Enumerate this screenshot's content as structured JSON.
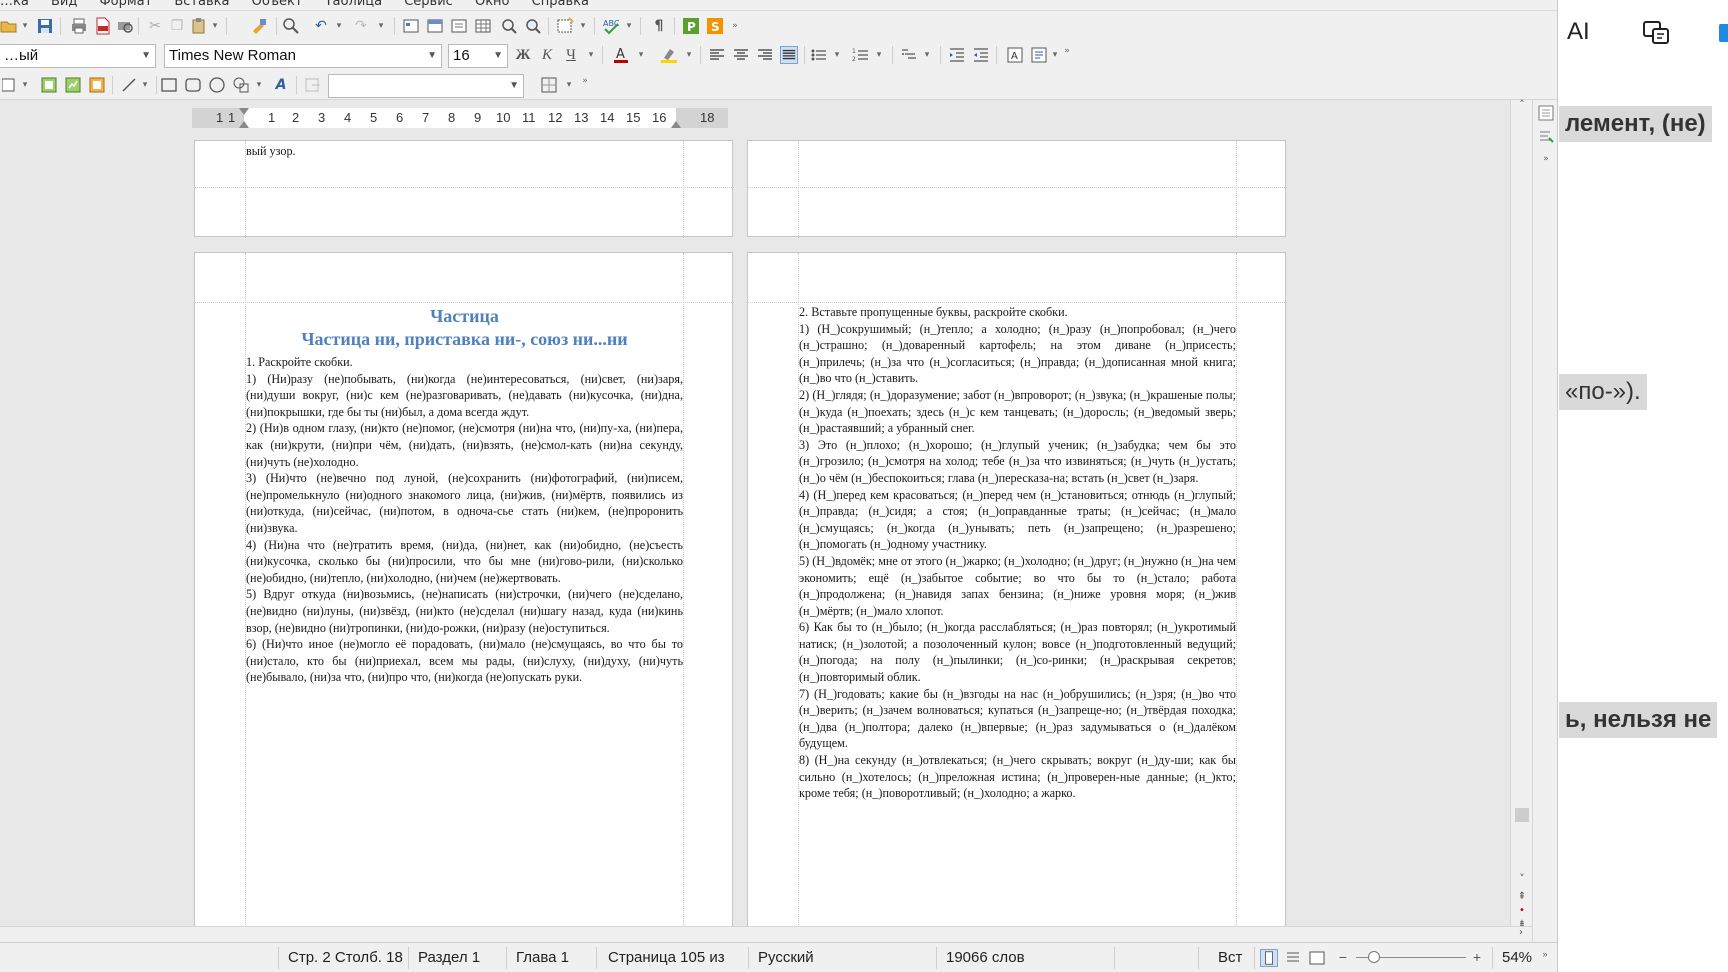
{
  "menubar": {
    "items": [
      "…ка",
      "Вид",
      "Формат",
      "Вставка",
      "Объект",
      "Таблица",
      "Сервис",
      "Окно",
      "Справка"
    ]
  },
  "formatting": {
    "paragraph_style": "…ый",
    "font_name": "Times New Roman",
    "font_size": "16"
  },
  "ruler": {
    "numbers": [
      "1",
      "1",
      "1",
      "2",
      "3",
      "4",
      "5",
      "6",
      "7",
      "8",
      "9",
      "10",
      "11",
      "12",
      "13",
      "14",
      "15",
      "16",
      "18"
    ]
  },
  "page_left_top": {
    "tail": "вый узор."
  },
  "page_left": {
    "title": "Частица",
    "subtitle": "Частица ни, приставка ни-, союз ни...ни",
    "paragraphs": [
      "1. Раскройте скобки.",
      "1) (Ни)разу (не)побывать, (ни)когда (не)интересоваться, (ни)свет, (ни)заря, (ни)души вокруг, (ни)с кем (не)разговаривать, (не)давать (ни)кусочка, (ни)дна, (ни)покрышки, где бы ты (ни)был, а дома всегда ждут.",
      "2) (Ни)в одном глазу, (ни)кто (не)помог, (не)смотря (ни)на что, (ни)пу-ха, (ни)пера, как (ни)крути, (ни)при чём, (ни)дать, (ни)взять, (не)смол-кать (ни)на секунду, (ни)чуть (не)холодно.",
      "3) (Ни)что (не)вечно под луной, (не)сохранить (ни)фотографий, (ни)писем, (не)промелькнуло (ни)одного знакомого лица, (ни)жив, (ни)мёртв, появились из (ни)откуда, (ни)сейчас, (ни)потом, в одноча-сье стать (ни)кем, (не)проронить (ни)звука.",
      "4) (Ни)на что (не)тратить время, (ни)да, (ни)нет, как (ни)обидно, (не)съесть (ни)кусочка, сколько бы (ни)просили, что бы мне (ни)гово-рили, (ни)сколько (не)обидно, (ни)тепло, (ни)холодно, (ни)чем (не)жертвовать.",
      "5) Вдруг откуда (ни)возьмись, (не)написать (ни)строчки, (ни)чего (не)сделано, (не)видно (ни)луны, (ни)звёзд, (ни)кто (не)сделал (ни)шагу назад, куда (ни)кинь взор, (не)видно (ни)тропинки, (ни)до-рожки, (ни)разу (не)оступиться.",
      "6) (Ни)что иное (не)могло её порадовать, (ни)мало (не)смущаясь, во что бы то (ни)стало, кто бы (ни)приехал, всем мы рады, (ни)слуху, (ни)духу, (ни)чуть (не)бывало, (ни)за что, (ни)про что, (ни)когда (не)опускать руки."
    ]
  },
  "page_right": {
    "paragraphs": [
      "2. Вставьте пропущенные буквы, раскройте скобки.",
      "1) (Н_)сокрушимый; (н_)тепло; а холодно; (н_)разу (н_)попробовал; (н_)чего (н_)страшно; (н_)доваренный картофель; на этом диване (н_)присесть; (н_)прилечь; (н_)за что (н_)согласиться; (н_)правда; (н_)дописанная мной книга; (н_)во что (н_)ставить.",
      "2) (Н_)глядя; (н_)доразумение; забот (н_)впроворот; (н_)звука; (н_)крашеные полы; (н_)куда (н_)поехать; здесь (н_)с кем танцевать; (н_)доросль; (н_)ведомый зверь; (н_)растаявший; а убранный снег.",
      "3) Это (н_)плохо; (н_)хорошо; (н_)глупый ученик; (н_)забудка; чем бы это (н_)грозило; (н_)смотря на холод; тебе (н_)за что извиняться; (н_)чуть (н_)устать; (н_)о чём (н_)беспокоиться; глава (н_)пересказа-на; встать (н_)свет (н_)заря.",
      "4) (Н_)перед кем красоваться; (н_)перед чем (н_)становиться; отнюдь (н_)глупый; (н_)правда; (н_)сидя; а стоя; (н_)оправданные траты; (н_)сейчас; (н_)мало (н_)смущаясь; (н_)когда (н_)унывать; петь (н_)запрещено; (н_)разрешено; (н_)помогать (н_)одному участнику.",
      "5) (Н_)вдомёк; мне от этого (н_)жарко; (н_)холодно; (н_)друг; (н_)нужно (н_)на чем экономить; ещё (н_)забытое событие; во что бы то (н_)стало; работа (н_)продолжена; (н_)навидя запах бензина; (н_)ниже уровня моря; (н_)жив (н_)мёртв; (н_)мало хлопот.",
      "6) Как бы то (н_)было; (н_)когда расслабляться; (н_)раз повторял; (н_)укротимый натиск; (н_)золотой; а позолоченный кулон; вовсе (н_)подготовленный ведущий; (н_)погода; на полу (н_)пылинки; (н_)со-ринки; (н_)раскрывая секретов; (н_)повторимый облик.",
      "7) (Н_)годовать; какие бы (н_)взгоды на нас (н_)обрушились; (н_)зря; (н_)во что (н_)верить; (н_)зачем волноваться; купаться (н_)запреще-но; (н_)твёрдая походка; (н_)два (н_)полтора; далеко (н_)впервые; (н_)раз задумываться о (н_)далёком будущем.",
      "8) (Н_)на секунду (н_)отвлекаться; (н_)чего скрывать; вокруг (н_)ду-ши; как бы сильно (н_)хотелось; (н_)преложная истина; (н_)проверен-ные данные; (н_)кто; кроме тебя; (н_)поворотливый; (н_)холодно; а жарко."
    ]
  },
  "statusbar": {
    "page_col": "Стр. 2 Столб. 18",
    "section": "Раздел 1",
    "chapter": "Глава 1",
    "page_count": "Страница 105 из",
    "language": "Русский",
    "word_count": "19066 слов",
    "insert_mode": "Вст",
    "zoom": "54%"
  },
  "background_window": {
    "ai_label": "AI",
    "snippet_1": "лемент, (не)",
    "snippet_2": "«по-»).",
    "snippet_3": "ь, нельзя не"
  },
  "colors": {
    "heading": "#4f81bd",
    "app_bg": "#f0f0f0",
    "doc_bg": "#e8e8e8",
    "font_color_accent": "#c00000",
    "highlight_accent": "#ffd200"
  }
}
